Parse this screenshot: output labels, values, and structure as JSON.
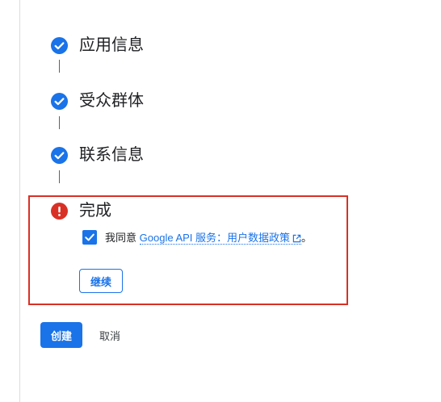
{
  "steps": [
    {
      "title": "应用信息",
      "status": "complete",
      "icon": "check-circle-icon"
    },
    {
      "title": "受众群体",
      "status": "complete",
      "icon": "check-circle-icon"
    },
    {
      "title": "联系信息",
      "status": "complete",
      "icon": "check-circle-icon"
    },
    {
      "title": "完成",
      "status": "error",
      "icon": "error-icon"
    }
  ],
  "consent": {
    "checked": true,
    "prefix": "我同意",
    "link_text": "Google API 服务：用户数据政策",
    "suffix": "。",
    "link_icon": "open-in-new-icon"
  },
  "continue_label": "继续",
  "actions": {
    "create_label": "创建",
    "cancel_label": "取消"
  },
  "colors": {
    "primary": "#1a73e8",
    "error": "#d93025",
    "text": "#202124"
  }
}
